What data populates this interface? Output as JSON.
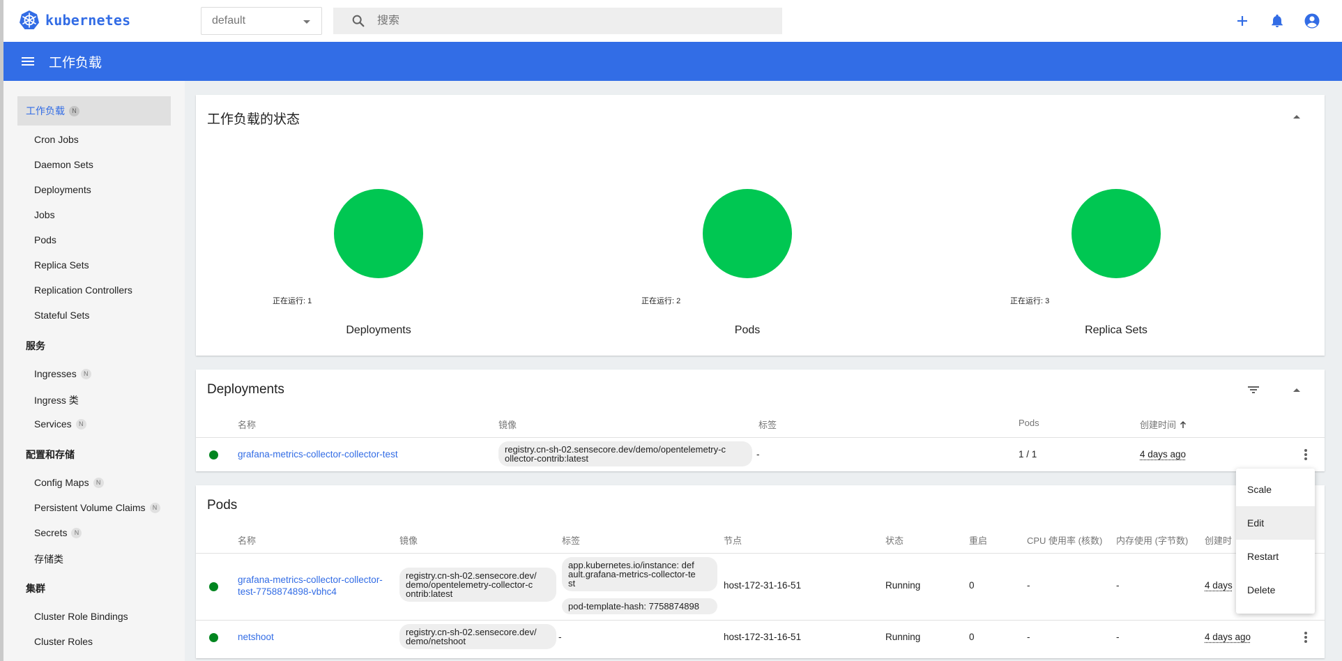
{
  "app": {
    "logo_text": "kubernetes",
    "brand_color": "#326ce5"
  },
  "toolbar": {
    "namespace": "default",
    "search_placeholder": "搜索",
    "icons": [
      "add-icon",
      "bell-icon",
      "account-circle-icon"
    ]
  },
  "header": {
    "title": "工作负载",
    "color": "#326de6"
  },
  "sidebar": {
    "active": {
      "label": "工作负载",
      "badge": "N"
    },
    "workloads": [
      "Cron Jobs",
      "Daemon Sets",
      "Deployments",
      "Jobs",
      "Pods",
      "Replica Sets",
      "Replication Controllers",
      "Stateful Sets"
    ],
    "service_group": "服务",
    "services": [
      {
        "label": "Ingresses",
        "badge": "N"
      },
      {
        "label": "Ingress 类",
        "badge": ""
      },
      {
        "label": "Services",
        "badge": "N"
      }
    ],
    "config_group": "配置和存储",
    "config": [
      {
        "label": "Config Maps",
        "badge": "N"
      },
      {
        "label": "Persistent Volume Claims",
        "badge": "N"
      },
      {
        "label": "Secrets",
        "badge": "N"
      },
      {
        "label": "存储类",
        "badge": ""
      }
    ],
    "cluster_group": "集群",
    "cluster": [
      "Cluster Role Bindings",
      "Cluster Roles"
    ]
  },
  "status_card": {
    "title": "工作负载的状态",
    "charts": [
      {
        "name": "Deployments",
        "label": "正在运行: 1",
        "running": 1,
        "color": "#00c752"
      },
      {
        "name": "Pods",
        "label": "正在运行: 2",
        "running": 2,
        "color": "#00c752"
      },
      {
        "name": "Replica Sets",
        "label": "正在运行: 3",
        "running": 3,
        "color": "#00c752"
      }
    ]
  },
  "deployments": {
    "title": "Deployments",
    "headers": {
      "name": "名称",
      "image": "镜像",
      "labels": "标签",
      "pods": "Pods",
      "created": "创建时间"
    },
    "sort_icon": "arrow-up-icon",
    "rows": [
      {
        "name": "grafana-metrics-collector-collector-test",
        "image_l1": "registry.cn-sh-02.sensecore.dev/demo/opentelemetry-c",
        "image_l2": "ollector-contrib:latest",
        "labels": "-",
        "pods": "1 / 1",
        "created": "4 days ago",
        "status_color": "#00851f"
      }
    ]
  },
  "pods": {
    "title": "Pods",
    "headers": {
      "name": "名称",
      "image": "镜像",
      "labels": "标签",
      "node": "节点",
      "status": "状态",
      "restarts": "重启",
      "cpu": "CPU 使用率 (核数)",
      "memory": "内存使用 (字节数)",
      "created": "创建时"
    },
    "rows": [
      {
        "name_l1": "grafana-metrics-collector-collector-",
        "name_l2": "test-7758874898-vbhc4",
        "image_l1": "registry.cn-sh-02.sensecore.dev/",
        "image_l2": "demo/opentelemetry-collector-c",
        "image_l3": "ontrib:latest",
        "label1_l1": "app.kubernetes.io/instance: def",
        "label1_l2": "ault.grafana-metrics-collector-te",
        "label1_l3": "st",
        "label2": "pod-template-hash: 7758874898",
        "node": "host-172-31-16-51",
        "status": "Running",
        "restarts": "0",
        "cpu": "-",
        "memory": "-",
        "created": "4 days"
      },
      {
        "name": "netshoot",
        "image_l1": "registry.cn-sh-02.sensecore.dev/",
        "image_l2": "demo/netshoot",
        "labels": "-",
        "node": "host-172-31-16-51",
        "status": "Running",
        "restarts": "0",
        "cpu": "-",
        "memory": "-",
        "created": "4 days ago"
      }
    ]
  },
  "context_menu": {
    "items": [
      "Scale",
      "Edit",
      "Restart",
      "Delete"
    ],
    "hovered": "Edit"
  }
}
